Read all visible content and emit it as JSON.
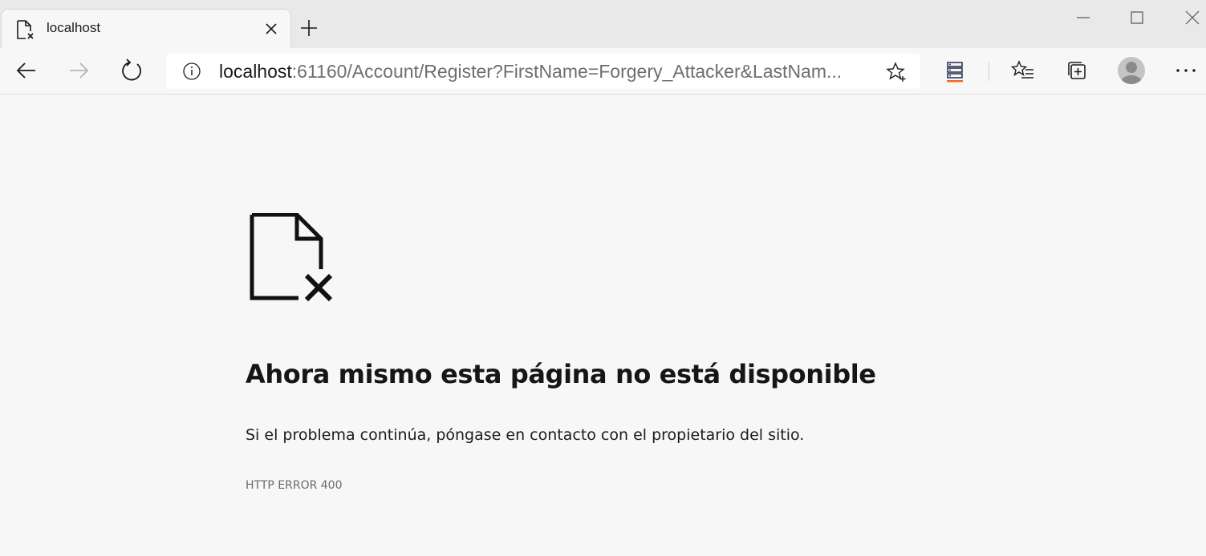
{
  "tab": {
    "title": "localhost",
    "favicon": "broken-page-icon"
  },
  "address_bar": {
    "host": "localhost",
    "path": ":61160/Account/Register?FirstName=Forgery_Attacker&LastNam...",
    "info_icon": "info-icon",
    "favorite_icon": "star-add-icon"
  },
  "toolbar": {
    "icons": [
      "back-arrow-icon",
      "forward-arrow-icon",
      "refresh-icon",
      "server-stack-icon",
      "favorites-icon",
      "collections-icon",
      "profile-avatar",
      "more-dots-icon"
    ]
  },
  "window_controls": [
    "minimize-icon",
    "maximize-icon",
    "close-window-icon"
  ],
  "error_page": {
    "heading": "Ahora mismo esta página no está disponible",
    "description": "Si el problema continúa, póngase en contacto con el propietario del sitio.",
    "code": "HTTP ERROR 400"
  },
  "colors": {
    "titlebar": "#e9e9e9",
    "page_background": "#f7f7f7",
    "server_icon_accent": "#f26b21"
  }
}
